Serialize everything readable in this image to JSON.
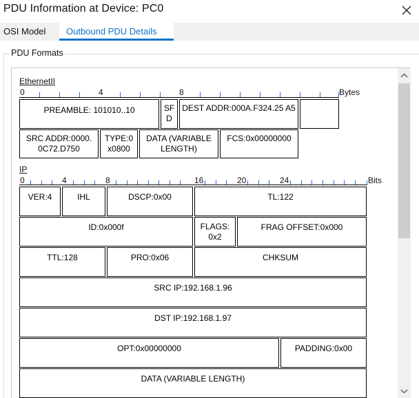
{
  "window": {
    "title": "PDU Information at Device: PC0"
  },
  "tabs": [
    {
      "label": "OSI Model"
    },
    {
      "label": "Outbound PDU Details"
    }
  ],
  "group": {
    "label": "PDU Formats"
  },
  "ethernet": {
    "label": "EthernetII",
    "ruler": {
      "ticks": [
        "0",
        "4",
        "8"
      ],
      "unit": "Bytes"
    },
    "row1": {
      "preamble": "PREAMBLE: 101010..10",
      "sfd": "SF D",
      "dest": "DEST ADDR:000A.F324.25 A5",
      "blank": ""
    },
    "row2": {
      "src": "SRC ADDR:0000. 0C72.D750",
      "type": "TYPE:0 x0800",
      "data": "DATA (VARIABLE LENGTH)",
      "fcs": "FCS:0x00000000"
    }
  },
  "ip": {
    "label": "IP",
    "ruler": {
      "ticks": [
        "0",
        "4",
        "8",
        "16",
        "20",
        "24"
      ],
      "unit": "Bits"
    },
    "ver": "VER:4",
    "ihl": "IHL",
    "dscp": "DSCP:0x00",
    "tl": "TL:122",
    "id": "ID:0x000f",
    "flags": "FLAGS: 0x2",
    "frag": "FRAG OFFSET:0x000",
    "ttl": "TTL:128",
    "pro": "PRO:0x06",
    "chksum": "CHKSUM",
    "src": "SRC IP:192.168.1.96",
    "dst": "DST IP:192.168.1.97",
    "opt": "OPT:0x00000000",
    "padding": "PADDING:0x00",
    "data": "DATA (VARIABLE LENGTH)"
  },
  "icons": {
    "close": "close-icon",
    "scroll_up": "scroll-up-arrow-icon",
    "scroll_down": "scroll-down-arrow-icon"
  }
}
